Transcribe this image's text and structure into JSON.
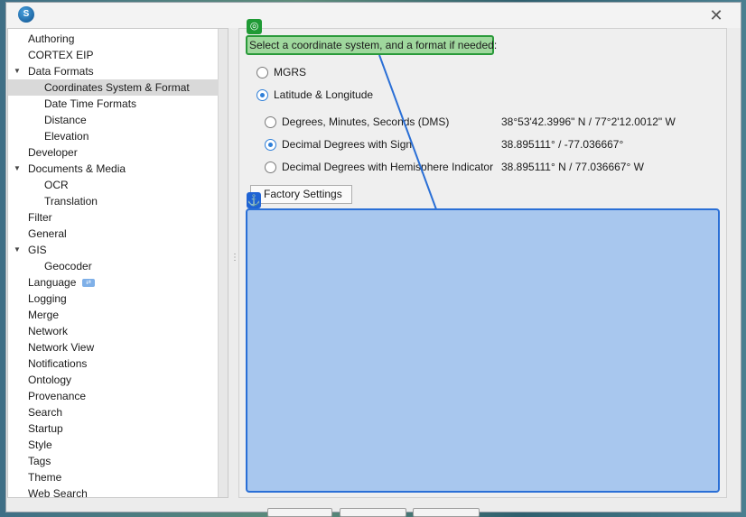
{
  "window": {
    "app_icon_text": "S",
    "close_glyph": "✕"
  },
  "tree": {
    "items": [
      {
        "label": "Authoring"
      },
      {
        "label": "CORTEX EIP"
      },
      {
        "label": "Data Formats",
        "expanded": true
      },
      {
        "label": "Coordinates System & Format",
        "child": true,
        "selected": true
      },
      {
        "label": "Date Time Formats",
        "child": true
      },
      {
        "label": "Distance",
        "child": true
      },
      {
        "label": "Elevation",
        "child": true
      },
      {
        "label": "Developer"
      },
      {
        "label": "Documents & Media",
        "expanded": true
      },
      {
        "label": "OCR",
        "child": true
      },
      {
        "label": "Translation",
        "child": true
      },
      {
        "label": "Filter"
      },
      {
        "label": "General"
      },
      {
        "label": "GIS",
        "expanded": true
      },
      {
        "label": "Geocoder",
        "child": true
      },
      {
        "label": "Language",
        "has_icon": true
      },
      {
        "label": "Logging"
      },
      {
        "label": "Merge"
      },
      {
        "label": "Network"
      },
      {
        "label": "Network View"
      },
      {
        "label": "Notifications"
      },
      {
        "label": "Ontology"
      },
      {
        "label": "Provenance"
      },
      {
        "label": "Search"
      },
      {
        "label": "Startup"
      },
      {
        "label": "Style"
      },
      {
        "label": "Tags"
      },
      {
        "label": "Theme"
      },
      {
        "label": "Web Search"
      }
    ],
    "expand_glyph": "▼"
  },
  "content": {
    "instruction": "Select a coordinate system, and a format if needed:",
    "system_options": [
      {
        "label": "MGRS",
        "selected": false
      },
      {
        "label": "Latitude & Longitude",
        "selected": true
      }
    ],
    "format_options": [
      {
        "label": "Degrees, Minutes, Seconds (DMS)",
        "example": "38°53'42.3996\" N / 77°2'12.0012\" W",
        "selected": false
      },
      {
        "label": "Decimal Degrees with Sign",
        "example": "38.895111° / -77.036667°",
        "selected": true
      },
      {
        "label": "Decimal Degrees with Hemisphere Indicator",
        "example": "38.895111° N / 77.036667° W",
        "selected": false
      }
    ],
    "factory_button": "Factory Settings"
  },
  "overlay": {
    "instruction_pin_glyph": "◎",
    "anchor_glyph": "⚓"
  },
  "colors": {
    "accent": "#2f7fd8",
    "overlay_green": "#9fd89d",
    "overlay_blue": "#a8c7ee"
  }
}
